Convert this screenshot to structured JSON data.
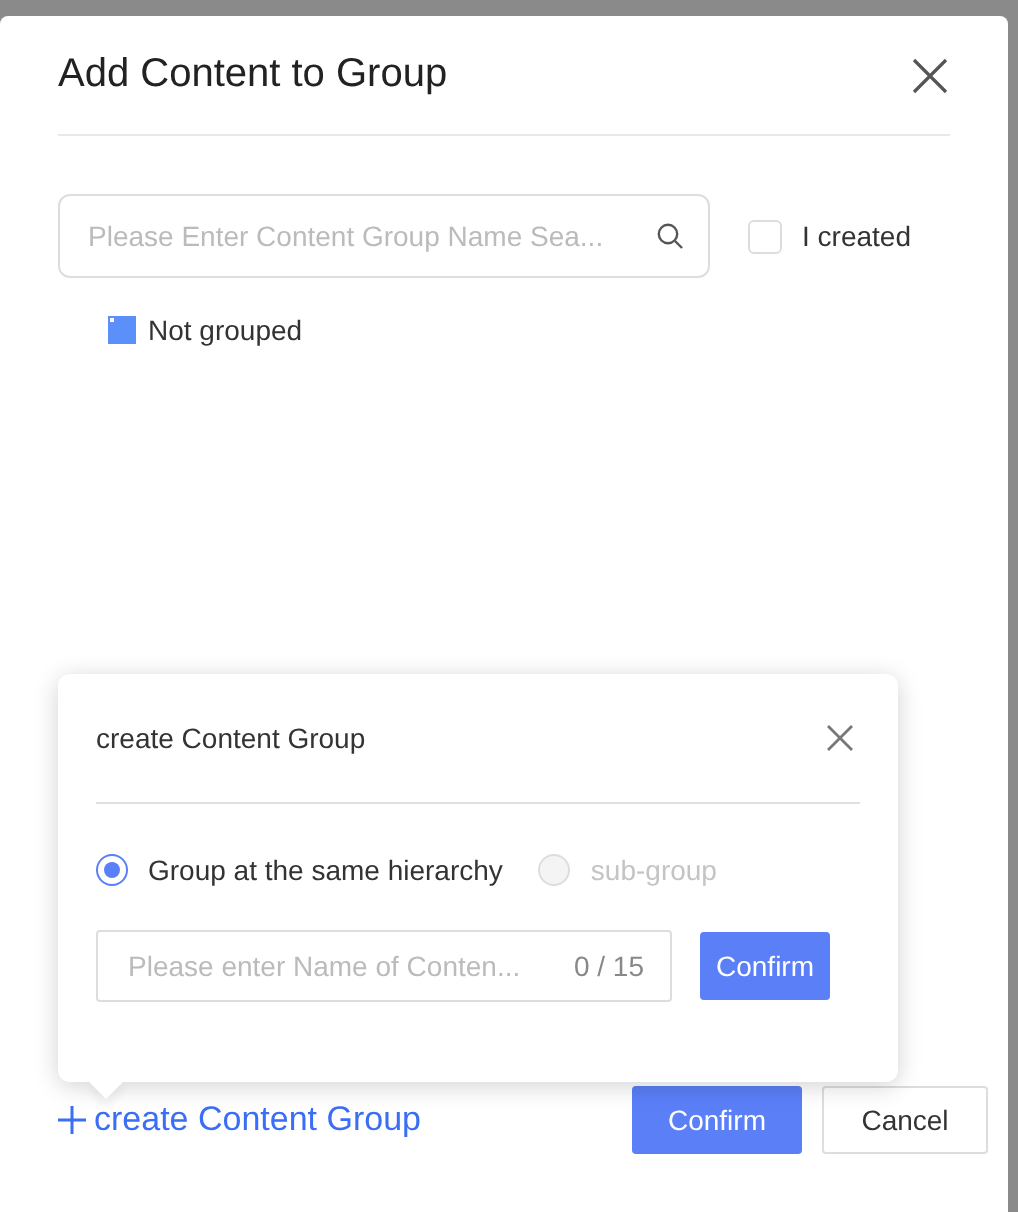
{
  "dialog": {
    "title": "Add Content to Group"
  },
  "search": {
    "placeholder": "Please Enter Content Group Name Sea..."
  },
  "filter": {
    "label": "I created",
    "checked": false
  },
  "groups": [
    {
      "label": "Not grouped",
      "selected": false
    }
  ],
  "popover": {
    "title": "create Content Group",
    "options": [
      {
        "label": "Group at the same hierarchy",
        "selected": true,
        "disabled": false
      },
      {
        "label": "sub-group",
        "selected": false,
        "disabled": true
      }
    ],
    "name_field": {
      "placeholder": "Please enter Name of Conten...",
      "counter": "0 / 15"
    },
    "confirm": "Confirm"
  },
  "footer": {
    "create_link": "create Content Group",
    "confirm": "Confirm",
    "cancel": "Cancel"
  }
}
